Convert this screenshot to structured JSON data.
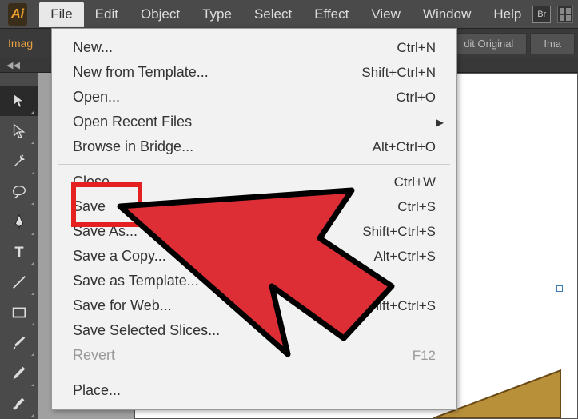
{
  "app": {
    "identity": "Ai",
    "bridge_icon": "Br"
  },
  "menubar": {
    "items": [
      "File",
      "Edit",
      "Object",
      "Type",
      "Select",
      "Effect",
      "View",
      "Window",
      "Help"
    ],
    "active_index": 0
  },
  "options": {
    "left_label": "Imag",
    "buttons": {
      "edit_original": "dit Original",
      "image_trace": "Ima"
    }
  },
  "collapse": {
    "chevrons": "◀◀"
  },
  "dropdown": {
    "items": [
      {
        "label": "New...",
        "shortcut": "Ctrl+N",
        "enabled": true
      },
      {
        "label": "New from Template...",
        "shortcut": "Shift+Ctrl+N",
        "enabled": true
      },
      {
        "label": "Open...",
        "shortcut": "Ctrl+O",
        "enabled": true
      },
      {
        "label": "Open Recent Files",
        "shortcut": "",
        "enabled": true,
        "submenu": true
      },
      {
        "label": "Browse in Bridge...",
        "shortcut": "Alt+Ctrl+O",
        "enabled": true
      },
      {
        "sep": true
      },
      {
        "label": "Close",
        "shortcut": "Ctrl+W",
        "enabled": true
      },
      {
        "label": "Save",
        "shortcut": "Ctrl+S",
        "enabled": true
      },
      {
        "label": "Save As...",
        "shortcut": "Shift+Ctrl+S",
        "enabled": true
      },
      {
        "label": "Save a Copy...",
        "shortcut": "Alt+Ctrl+S",
        "enabled": true
      },
      {
        "label": "Save as Template...",
        "shortcut": "",
        "enabled": true
      },
      {
        "label": "Save for Web...",
        "shortcut": "Alt+Shift+Ctrl+S",
        "enabled": true
      },
      {
        "label": "Save Selected Slices...",
        "shortcut": "",
        "enabled": true
      },
      {
        "label": "Revert",
        "shortcut": "F12",
        "enabled": false
      },
      {
        "sep": true
      },
      {
        "label": "Place...",
        "shortcut": "",
        "enabled": true
      }
    ]
  },
  "highlight": {
    "target_item_index": 7
  },
  "tools": [
    "selection",
    "direct-selection",
    "magic-wand",
    "lasso",
    "pen",
    "type",
    "line",
    "rectangle",
    "paintbrush",
    "pencil",
    "blob-brush"
  ]
}
